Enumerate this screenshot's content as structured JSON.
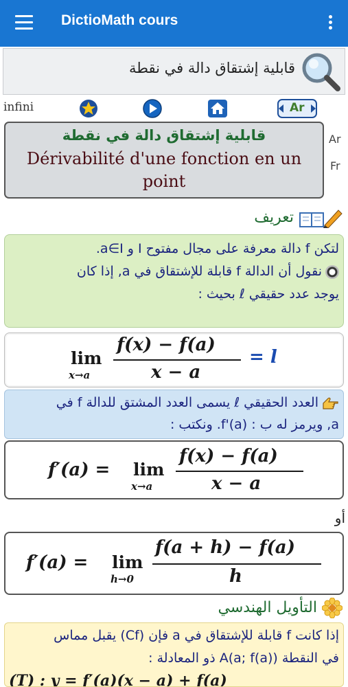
{
  "app": {
    "title": "DictioMath cours"
  },
  "search": {
    "query": "قابلية إشتقاق دالة في نقطة"
  },
  "toolbar": {
    "mode_label": "infini",
    "lang_toggle_label": "Ar"
  },
  "entry": {
    "title_ar": "قابلية إشتقاق دالة في نقطة",
    "title_fr": "Dérivabilité d'une fonction en un point",
    "lang_ar_label": "Ar",
    "lang_fr_label": "Fr"
  },
  "sections": {
    "definition_title": "تعريف",
    "geometric_title": "التأويل الهندسي"
  },
  "definition": {
    "line1": "لتكن f دالة معرفة على مجال مفتوح I و a∈I.",
    "line2": "نقول أن الدالة f قابلة للإشتقاق في a, إذا كان",
    "line3": "يوجد عدد حقيقي ℓ بحيث :"
  },
  "formula1": {
    "lim": "lim",
    "sub": "x→a",
    "num": "f(x) − f(a)",
    "den": "x − a",
    "rhs": "= l"
  },
  "note": {
    "line1": "العدد الحقيقي ℓ يسمى العدد المشتق للدالة f في",
    "line2": "a, ويرمز له ب : f'(a). ونكتب :"
  },
  "formula2": {
    "lhs": "f′(a) =",
    "lim": "lim",
    "sub": "x→a",
    "num": "f(x) − f(a)",
    "den": "x − a"
  },
  "or_label": "أو",
  "formula3": {
    "lhs": "f′(a) =",
    "lim": "lim",
    "sub": "h→0",
    "num": "f(a + h) − f(a)",
    "den": "h"
  },
  "geometric": {
    "line1": "إذا كانت f قابلة للإشتقاق في a فإن (Cf) يقبل مماس",
    "line2": "في النقطة A(a; f(a)) ذو المعادلة :",
    "line3": "(T) : y = f′(a)(x − a) + f(a)"
  },
  "colors": {
    "appbar": "#1976d2",
    "definition_bg": "#dcefc4",
    "note_bg": "#d0e4f5",
    "geometric_bg": "#fff6cc",
    "title_green": "#1f6b31",
    "math_red": "#a32035"
  },
  "icons": [
    "menu-icon",
    "more-vert-icon",
    "magnifier-icon",
    "star-icon",
    "play-icon",
    "home-icon",
    "language-toggle-icon",
    "book-pencil-icon",
    "radio-bullet-icon",
    "pointing-hand-icon",
    "flower-icon"
  ]
}
